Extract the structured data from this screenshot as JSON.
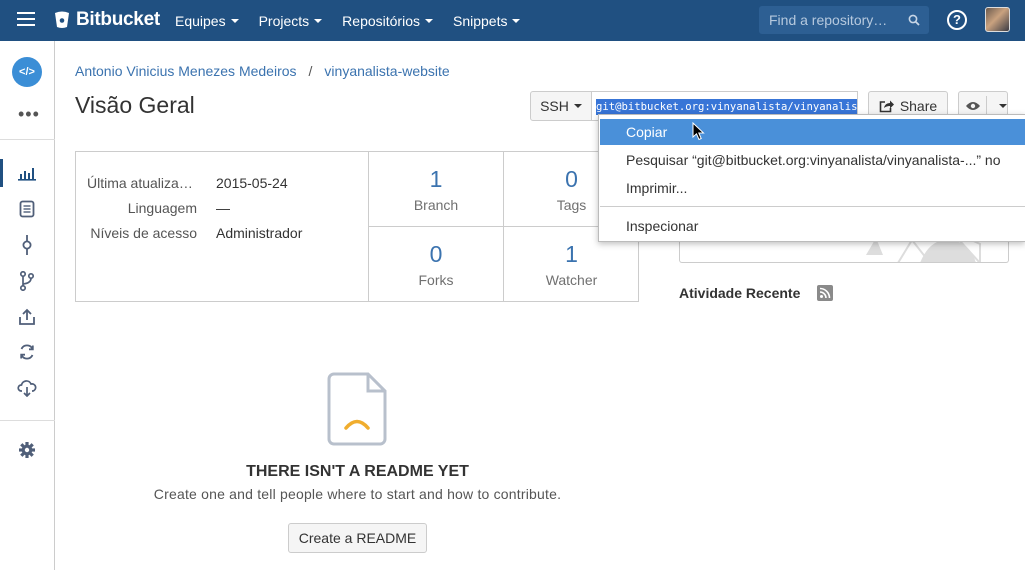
{
  "topbar": {
    "brand": "Bitbucket",
    "nav": [
      {
        "label": "Equipes"
      },
      {
        "label": "Projects"
      },
      {
        "label": "Repositórios"
      },
      {
        "label": "Snippets"
      }
    ],
    "search_placeholder": "Find a repository…",
    "help_label": "?"
  },
  "sidebar": {
    "repo_icon_label": "</>",
    "more_label": "•••"
  },
  "breadcrumb": {
    "owner": "Antonio Vinicius Menezes Medeiros",
    "separator": "/",
    "repo": "vinyanalista-website"
  },
  "page_title": "Visão Geral",
  "clone": {
    "protocol": "SSH",
    "url": "git@bitbucket.org:vinyanalista/vinyanalista-website.git"
  },
  "share_label": "Share",
  "meta": [
    {
      "key": "Última atualização",
      "value": "2015-05-24"
    },
    {
      "key": "Linguagem",
      "value": "—"
    },
    {
      "key": "Níveis de acesso",
      "value": "Administrador"
    }
  ],
  "stats": [
    {
      "value": "1",
      "label": "Branch"
    },
    {
      "value": "0",
      "label": "Tags"
    },
    {
      "value": "0",
      "label": "Forks"
    },
    {
      "value": "1",
      "label": "Watcher"
    }
  ],
  "recent_activity_title": "Atividade Recente",
  "readme": {
    "title": "THERE ISN'T A README YET",
    "description": "Create one and tell people where to start and how to contribute.",
    "button": "Create a README"
  },
  "context_menu": {
    "items": [
      {
        "label": "Copiar"
      },
      {
        "label": "Pesquisar “git@bitbucket.org:vinyanalista/vinyanalista-...” no"
      },
      {
        "label": "Imprimir..."
      },
      {
        "label": "Inspecionar"
      }
    ]
  },
  "colors": {
    "header": "#205081",
    "link": "#3b73af",
    "selection": "#3875d7",
    "menu_hover": "#4a90d9",
    "readme_accent": "#f0ad2e"
  }
}
